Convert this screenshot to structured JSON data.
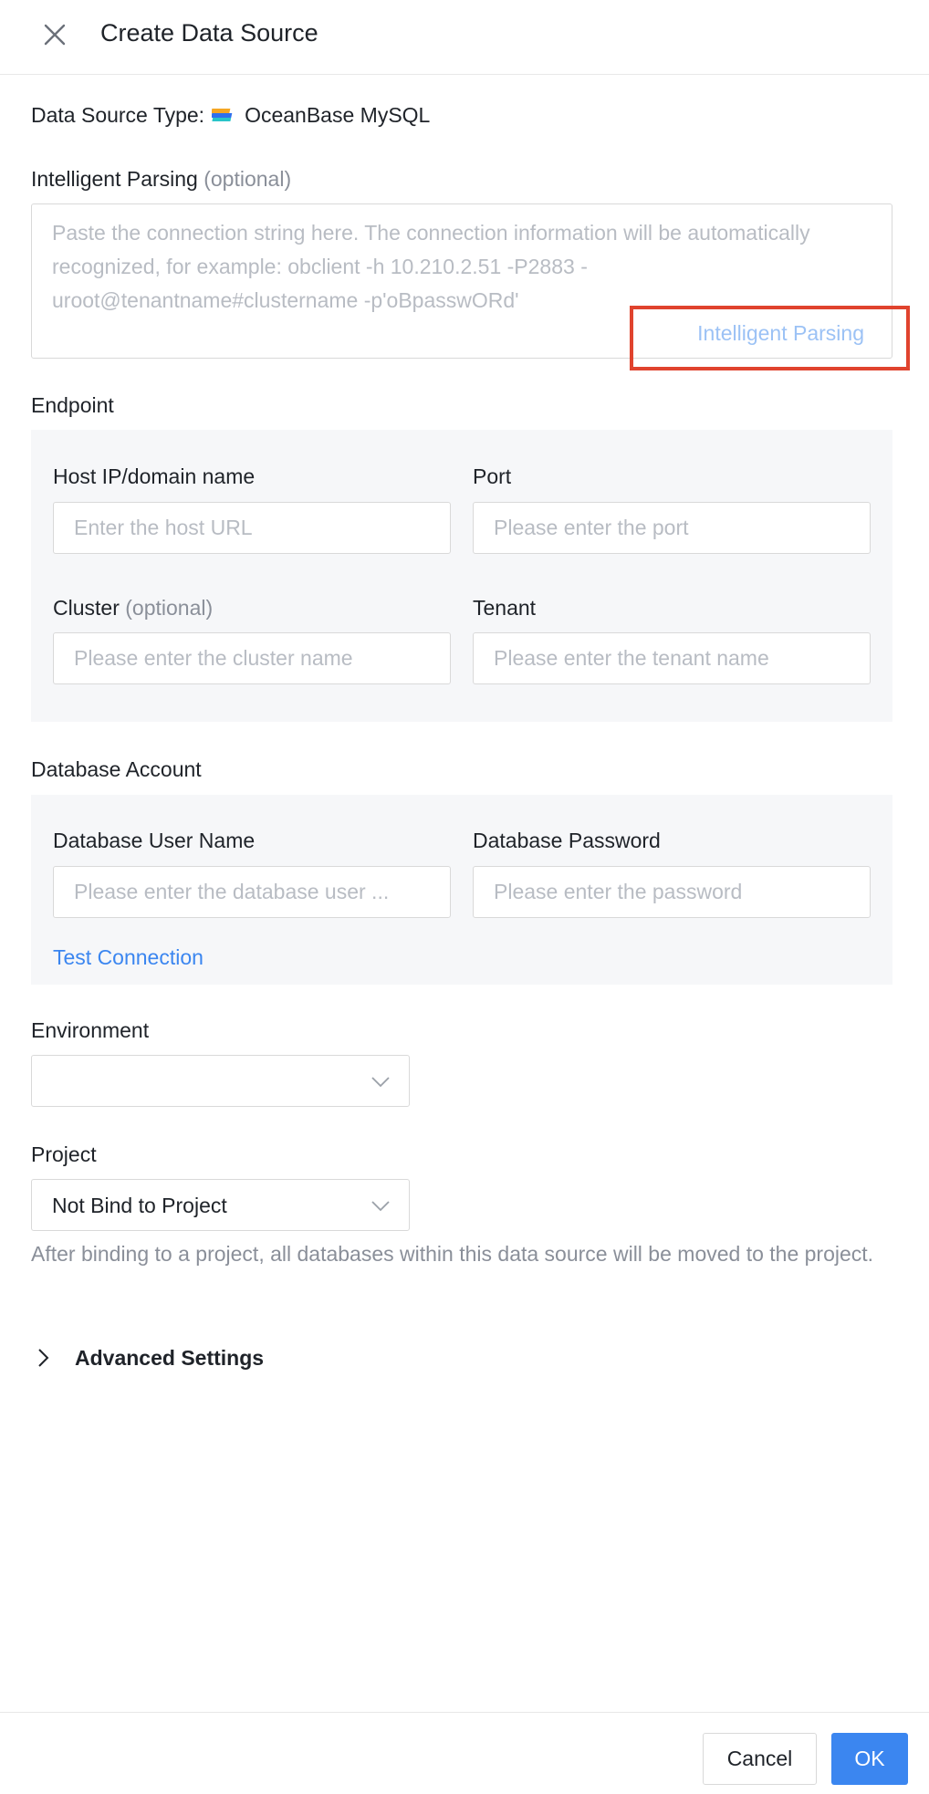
{
  "header": {
    "title": "Create Data Source",
    "close_icon": "close-icon"
  },
  "data_source_type": {
    "label": "Data Source Type:",
    "value": "OceanBase MySQL",
    "logo_icon": "oceanbase-logo-icon"
  },
  "intelligent_parsing": {
    "label": "Intelligent Parsing",
    "optional": "(optional)",
    "placeholder": "Paste the connection string here. The connection information will be automatically recognized, for example: obclient -h 10.210.2.51 -P2883 -uroot@tenantname#clustername -p'oBpasswORd'",
    "button_label": "Intelligent Parsing",
    "highlight_color": "#e0432e"
  },
  "endpoint": {
    "section_label": "Endpoint",
    "host": {
      "label": "Host IP/domain name",
      "placeholder": "Enter the host URL"
    },
    "port": {
      "label": "Port",
      "placeholder": "Please enter the port"
    },
    "cluster": {
      "label": "Cluster",
      "optional": "(optional)",
      "placeholder": "Please enter the cluster name"
    },
    "tenant": {
      "label": "Tenant",
      "placeholder": "Please enter the tenant name"
    }
  },
  "database_account": {
    "section_label": "Database Account",
    "username": {
      "label": "Database User Name",
      "placeholder": "Please enter the database user ..."
    },
    "password": {
      "label": "Database Password",
      "placeholder": "Please enter the password"
    },
    "test_connection": "Test Connection"
  },
  "environment": {
    "label": "Environment",
    "value": ""
  },
  "project": {
    "label": "Project",
    "value": "Not Bind to Project",
    "help": "After binding to a project, all databases within this data source will be moved to the project."
  },
  "advanced_settings": {
    "label": "Advanced Settings",
    "icon": "chevron-right-icon"
  },
  "footer": {
    "cancel": "Cancel",
    "ok": "OK"
  },
  "colors": {
    "primary": "#3b86f0",
    "panel_bg": "#f6f7f9",
    "border": "#d9d9d9",
    "placeholder": "#b8bcc3"
  }
}
